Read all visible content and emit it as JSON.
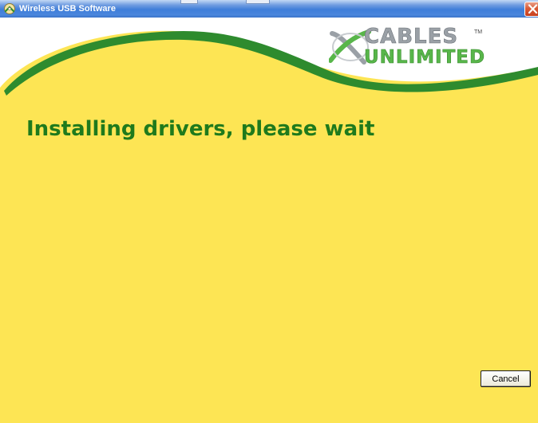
{
  "window": {
    "title": "Wireless USB Software",
    "title_icon": "installer-disc-icon",
    "close_icon": "close-icon"
  },
  "header": {
    "logo": {
      "line1": "CABLES",
      "line1_mark": "TM",
      "line2": "UNLIMITED",
      "logo_icon": "x-swoosh-icon"
    }
  },
  "main": {
    "heading": "Installing drivers, please wait"
  },
  "footer": {
    "cancel_label": "Cancel"
  },
  "colors": {
    "background_yellow": "#fde554",
    "heading_green": "#1f7a1c",
    "swoosh_green": "#2e8b2e",
    "logo_grey": "#9aa0a6",
    "logo_green": "#58b64a",
    "titlebar_blue": "#3f7ed9",
    "close_red": "#d85a36"
  }
}
